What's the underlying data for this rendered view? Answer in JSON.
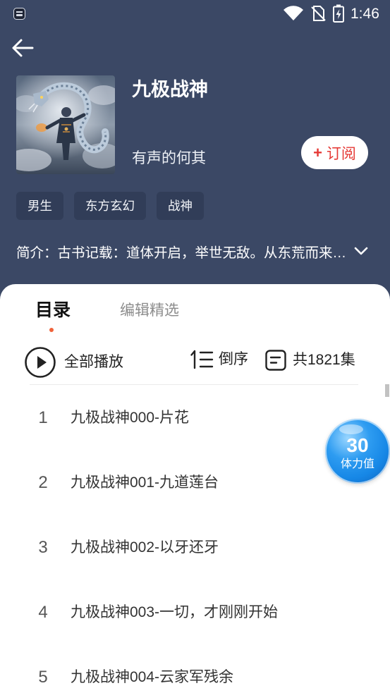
{
  "status_bar": {
    "time": "1:46",
    "icons": [
      "app-notification-icon",
      "wifi-icon",
      "no-sim-icon",
      "battery-charging-icon"
    ]
  },
  "header": {
    "back_icon": "arrow-left-icon",
    "title": "九极战神",
    "author": "有声的何其",
    "subscribe": {
      "icon": "+",
      "label": "订阅"
    }
  },
  "tags": [
    "男生",
    "东方玄幻",
    "战神"
  ],
  "synopsis": {
    "text": "简介：古书记载：道体开启，举世无敌。从东荒而来…",
    "expand_icon": "chevron-down-icon"
  },
  "tabs": [
    {
      "label": "目录",
      "active": true
    },
    {
      "label": "编辑精选",
      "active": false
    }
  ],
  "toolbar": {
    "play_all_label": "全部播放",
    "sort_label": "倒序",
    "episode_count_label": "共1821集"
  },
  "episodes": [
    {
      "number": "1",
      "title": "九极战神000-片花"
    },
    {
      "number": "2",
      "title": "九极战神001-九道莲台"
    },
    {
      "number": "3",
      "title": "九极战神002-以牙还牙"
    },
    {
      "number": "4",
      "title": "九极战神003-一切，才刚刚开始"
    },
    {
      "number": "5",
      "title": "九极战神004-云家军残余"
    }
  ],
  "stamina_badge": {
    "value": "30",
    "label": "体力值"
  },
  "colors": {
    "header_bg": "#3b4865",
    "tag_bg": "#313d58",
    "accent": "#f0633a",
    "subscribe_text": "#e53935",
    "badge_blue": "#1687e6"
  }
}
